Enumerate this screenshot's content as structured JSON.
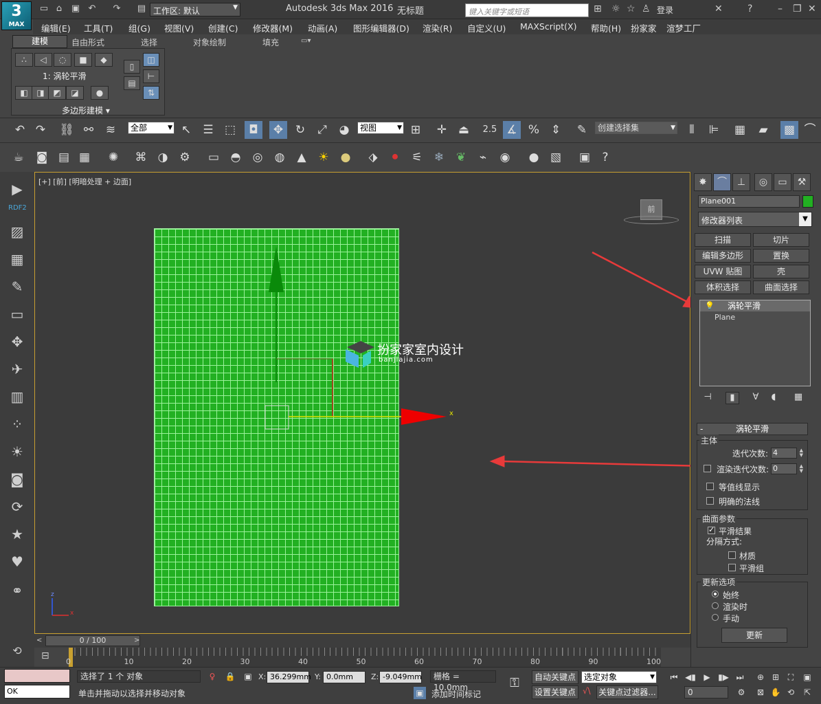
{
  "app": {
    "logo_text": "MAX",
    "title": "Autodesk 3ds Max 2016",
    "doc_title": "无标题",
    "workspace": "工作区: 默认",
    "search_placeholder": "键入关键字或短语",
    "login": "登录"
  },
  "menu": [
    "编辑(E)",
    "工具(T)",
    "组(G)",
    "视图(V)",
    "创建(C)",
    "修改器(M)",
    "动画(A)",
    "图形编辑器(D)",
    "渲染(R)",
    "自定义(U)",
    "MAXScript(X)",
    "帮助(H)",
    "扮家家",
    "渲梦工厂"
  ],
  "ribbon": {
    "tabs": [
      "建模",
      "自由形式",
      "选择",
      "对象绘制",
      "填充"
    ],
    "active_tab": "建模",
    "panel_label": "1: 涡轮平滑",
    "panel_footer": "多边形建模"
  },
  "toolbar": {
    "filter_select": "全部",
    "ref_coord": "视图",
    "snap_value": "2.5",
    "named_selection": "创建选择集"
  },
  "sidebar": {
    "brand": "RDF2"
  },
  "viewport": {
    "label": "[+] [前] [明暗处理 + 边面]",
    "viewcube_face": "前",
    "watermark_title": "扮家家室内设计",
    "watermark_url": "banjiajia.com",
    "gizmo_axis": "x",
    "axis_z": "z",
    "axis_x": "x"
  },
  "command_panel": {
    "object_name": "Plane001",
    "object_color": "#22b022",
    "modifier_list": "修改器列表",
    "modifier_buttons": [
      "扫描",
      "切片",
      "编辑多边形",
      "置换",
      "UVW 贴图",
      "壳",
      "体积选择",
      "曲面选择"
    ],
    "stack": [
      "涡轮平滑",
      "Plane"
    ],
    "rollout_title": "涡轮平滑",
    "main_group": "主体",
    "iterations_label": "迭代次数:",
    "iterations_value": "4",
    "render_iters_label": "渲染迭代次数:",
    "render_iters_value": "0",
    "isoline_label": "等值线显示",
    "explicit_normals_label": "明确的法线",
    "surface_group": "曲面参数",
    "smooth_result_label": "平滑结果",
    "separate_by_label": "分隔方式:",
    "materials_label": "材质",
    "smoothing_groups_label": "平滑组",
    "update_group": "更新选项",
    "always_label": "始终",
    "when_rendering_label": "渲染时",
    "manually_label": "手动",
    "update_button": "更新"
  },
  "timeline": {
    "slider": "0 / 100",
    "ticks": [
      "0",
      "10",
      "20",
      "30",
      "40",
      "50",
      "60",
      "70",
      "80",
      "90",
      "100"
    ]
  },
  "status": {
    "ok_label": "OK",
    "selection": "选择了 1 个 对象",
    "prompt": "单击并拖动以选择并移动对象",
    "x_label": "X:",
    "x_value": "36.299mm",
    "y_label": "Y:",
    "y_value": "0.0mm",
    "z_label": "Z:",
    "z_value": "-9.049mm",
    "grid": "栅格 = 10.0mm",
    "add_time_tag": "添加时间标记",
    "auto_key": "自动关键点",
    "set_key": "设置关键点",
    "selected_object": "选定对象",
    "key_filters": "关键点过滤器...",
    "frame_value": "0"
  },
  "colors": {
    "plane_green": "#22b022",
    "grid_line": "#9bf29b",
    "viewport_border": "#c8a030",
    "annotation_arrow": "#e83a3a"
  }
}
